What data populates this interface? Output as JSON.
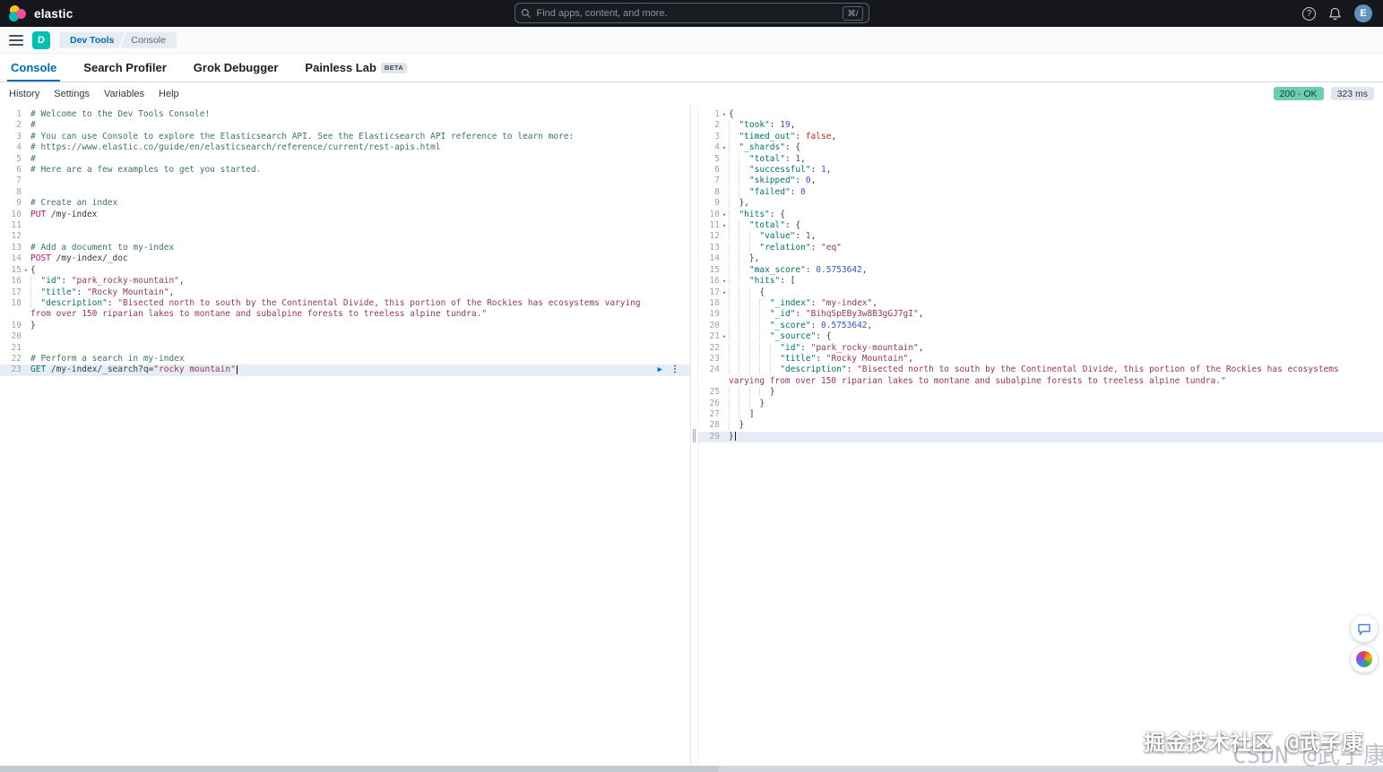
{
  "topbar": {
    "brand": "elastic",
    "search_placeholder": "Find apps, content, and more.",
    "search_shortcut": "⌘/",
    "avatar_initial": "E"
  },
  "breadcrumbs": {
    "space_initial": "D",
    "items": [
      "Dev Tools",
      "Console"
    ]
  },
  "tabs": [
    {
      "label": "Console",
      "active": true
    },
    {
      "label": "Search Profiler"
    },
    {
      "label": "Grok Debugger"
    },
    {
      "label": "Painless Lab",
      "badge": "BETA"
    }
  ],
  "toolbar": {
    "items": [
      "History",
      "Settings",
      "Variables",
      "Help"
    ],
    "status_badge": "200 - OK",
    "time_badge": "323 ms"
  },
  "icons": {
    "fold": "▾",
    "play": "▶",
    "kebab": "⋮",
    "help": "?"
  },
  "colors": {
    "accent": "#006bb4",
    "status_ok_bg": "#6dccb1",
    "method_pink": "#c80a68",
    "key_teal": "#00756c",
    "string_maroon": "#9a3558",
    "number_blue": "#3b53c4",
    "comment_green": "#41755c"
  },
  "watermark": {
    "primary": "掘金技术社区 @武子康",
    "secondary": "CSDN @武子康"
  },
  "editor": {
    "request_lines": [
      {
        "n": 1,
        "t": [
          [
            "c",
            "# Welcome to the Dev Tools Console!"
          ]
        ]
      },
      {
        "n": 2,
        "t": [
          [
            "c",
            "#"
          ]
        ]
      },
      {
        "n": 3,
        "t": [
          [
            "c",
            "# You can use Console to explore the Elasticsearch API. See the Elasticsearch API reference to learn more:"
          ]
        ]
      },
      {
        "n": 4,
        "t": [
          [
            "c",
            "# https://www.elastic.co/guide/en/elasticsearch/reference/current/rest-apis.html"
          ]
        ]
      },
      {
        "n": 5,
        "t": [
          [
            "c",
            "#"
          ]
        ]
      },
      {
        "n": 6,
        "t": [
          [
            "c",
            "# Here are a few examples to get you started."
          ]
        ]
      },
      {
        "n": 7,
        "t": []
      },
      {
        "n": 8,
        "t": []
      },
      {
        "n": 9,
        "t": [
          [
            "c",
            "# Create an index"
          ]
        ]
      },
      {
        "n": 10,
        "t": [
          [
            "m",
            "PUT"
          ],
          [
            "p",
            " "
          ],
          [
            "u",
            "/my-index"
          ]
        ]
      },
      {
        "n": 11,
        "t": []
      },
      {
        "n": 12,
        "t": []
      },
      {
        "n": 13,
        "t": [
          [
            "c",
            "# Add a document to my-index"
          ]
        ]
      },
      {
        "n": 14,
        "t": [
          [
            "m",
            "POST"
          ],
          [
            "p",
            " "
          ],
          [
            "u",
            "/my-index/_doc"
          ]
        ]
      },
      {
        "n": 15,
        "fold": true,
        "t": [
          [
            "p",
            "{"
          ]
        ]
      },
      {
        "n": 16,
        "t": [
          [
            "i",
            "  "
          ],
          [
            "k",
            "\"id\""
          ],
          [
            "p",
            ": "
          ],
          [
            "s",
            "\"park_rocky-mountain\""
          ],
          [
            "p",
            ","
          ]
        ]
      },
      {
        "n": 17,
        "t": [
          [
            "i",
            "  "
          ],
          [
            "k",
            "\"title\""
          ],
          [
            "p",
            ": "
          ],
          [
            "s",
            "\"Rocky Mountain\""
          ],
          [
            "p",
            ","
          ]
        ]
      },
      {
        "n": 18,
        "t": [
          [
            "i",
            "  "
          ],
          [
            "k",
            "\"description\""
          ],
          [
            "p",
            ": "
          ],
          [
            "s",
            "\"Bisected north to south by the Continental Divide, this portion of the Rockies has ecosystems varying from over 150 riparian lakes to montane and subalpine forests to treeless alpine tundra.\""
          ]
        ]
      },
      {
        "n": 19,
        "t": [
          [
            "p",
            "}"
          ]
        ]
      },
      {
        "n": 20,
        "t": []
      },
      {
        "n": 21,
        "t": []
      },
      {
        "n": 22,
        "t": [
          [
            "c",
            "# Perform a search in my-index"
          ]
        ]
      },
      {
        "n": 23,
        "hl": true,
        "cursor": true,
        "actions": true,
        "t": [
          [
            "gm",
            "GET"
          ],
          [
            "p",
            " "
          ],
          [
            "u",
            "/my-index/_search?q="
          ],
          [
            "s",
            "\"rocky mountain\""
          ]
        ]
      }
    ],
    "response_lines": [
      {
        "n": 1,
        "fold": true,
        "t": [
          [
            "p",
            "{"
          ]
        ]
      },
      {
        "n": 2,
        "t": [
          [
            "i",
            "  "
          ],
          [
            "k",
            "\"took\""
          ],
          [
            "p",
            ": "
          ],
          [
            "n",
            "19"
          ],
          [
            "p",
            ","
          ]
        ]
      },
      {
        "n": 3,
        "t": [
          [
            "i",
            "  "
          ],
          [
            "k",
            "\"timed_out\""
          ],
          [
            "p",
            ": "
          ],
          [
            "b",
            "false"
          ],
          [
            "p",
            ","
          ]
        ]
      },
      {
        "n": 4,
        "fold": true,
        "t": [
          [
            "i",
            "  "
          ],
          [
            "k",
            "\"_shards\""
          ],
          [
            "p",
            ": {"
          ]
        ]
      },
      {
        "n": 5,
        "t": [
          [
            "i",
            "  "
          ],
          [
            "i",
            "  "
          ],
          [
            "k",
            "\"total\""
          ],
          [
            "p",
            ": "
          ],
          [
            "n",
            "1"
          ],
          [
            "p",
            ","
          ]
        ]
      },
      {
        "n": 6,
        "t": [
          [
            "i",
            "  "
          ],
          [
            "i",
            "  "
          ],
          [
            "k",
            "\"successful\""
          ],
          [
            "p",
            ": "
          ],
          [
            "n",
            "1"
          ],
          [
            "p",
            ","
          ]
        ]
      },
      {
        "n": 7,
        "t": [
          [
            "i",
            "  "
          ],
          [
            "i",
            "  "
          ],
          [
            "k",
            "\"skipped\""
          ],
          [
            "p",
            ": "
          ],
          [
            "n",
            "0"
          ],
          [
            "p",
            ","
          ]
        ]
      },
      {
        "n": 8,
        "t": [
          [
            "i",
            "  "
          ],
          [
            "i",
            "  "
          ],
          [
            "k",
            "\"failed\""
          ],
          [
            "p",
            ": "
          ],
          [
            "n",
            "0"
          ]
        ]
      },
      {
        "n": 9,
        "t": [
          [
            "i",
            "  "
          ],
          [
            "p",
            "},"
          ]
        ]
      },
      {
        "n": 10,
        "fold": true,
        "t": [
          [
            "i",
            "  "
          ],
          [
            "k",
            "\"hits\""
          ],
          [
            "p",
            ": {"
          ]
        ]
      },
      {
        "n": 11,
        "fold": true,
        "t": [
          [
            "i",
            "  "
          ],
          [
            "i",
            "  "
          ],
          [
            "k",
            "\"total\""
          ],
          [
            "p",
            ": {"
          ]
        ]
      },
      {
        "n": 12,
        "t": [
          [
            "i",
            "  "
          ],
          [
            "i",
            "  "
          ],
          [
            "i",
            "  "
          ],
          [
            "k",
            "\"value\""
          ],
          [
            "p",
            ": "
          ],
          [
            "n",
            "1"
          ],
          [
            "p",
            ","
          ]
        ]
      },
      {
        "n": 13,
        "t": [
          [
            "i",
            "  "
          ],
          [
            "i",
            "  "
          ],
          [
            "i",
            "  "
          ],
          [
            "k",
            "\"relation\""
          ],
          [
            "p",
            ": "
          ],
          [
            "s",
            "\"eq\""
          ]
        ]
      },
      {
        "n": 14,
        "t": [
          [
            "i",
            "  "
          ],
          [
            "i",
            "  "
          ],
          [
            "p",
            "},"
          ]
        ]
      },
      {
        "n": 15,
        "t": [
          [
            "i",
            "  "
          ],
          [
            "i",
            "  "
          ],
          [
            "k",
            "\"max_score\""
          ],
          [
            "p",
            ": "
          ],
          [
            "n",
            "0.5753642"
          ],
          [
            "p",
            ","
          ]
        ]
      },
      {
        "n": 16,
        "fold": true,
        "t": [
          [
            "i",
            "  "
          ],
          [
            "i",
            "  "
          ],
          [
            "k",
            "\"hits\""
          ],
          [
            "p",
            ": ["
          ]
        ]
      },
      {
        "n": 17,
        "fold": true,
        "t": [
          [
            "i",
            "  "
          ],
          [
            "i",
            "  "
          ],
          [
            "i",
            "  "
          ],
          [
            "p",
            "{"
          ]
        ]
      },
      {
        "n": 18,
        "t": [
          [
            "i",
            "  "
          ],
          [
            "i",
            "  "
          ],
          [
            "i",
            "  "
          ],
          [
            "i",
            "  "
          ],
          [
            "k",
            "\"_index\""
          ],
          [
            "p",
            ": "
          ],
          [
            "s",
            "\"my-index\""
          ],
          [
            "p",
            ","
          ]
        ]
      },
      {
        "n": 19,
        "t": [
          [
            "i",
            "  "
          ],
          [
            "i",
            "  "
          ],
          [
            "i",
            "  "
          ],
          [
            "i",
            "  "
          ],
          [
            "k",
            "\"_id\""
          ],
          [
            "p",
            ": "
          ],
          [
            "s",
            "\"BihqSpEBy3w8B3gGJ7gI\""
          ],
          [
            "p",
            ","
          ]
        ]
      },
      {
        "n": 20,
        "t": [
          [
            "i",
            "  "
          ],
          [
            "i",
            "  "
          ],
          [
            "i",
            "  "
          ],
          [
            "i",
            "  "
          ],
          [
            "k",
            "\"_score\""
          ],
          [
            "p",
            ": "
          ],
          [
            "n",
            "0.5753642"
          ],
          [
            "p",
            ","
          ]
        ]
      },
      {
        "n": 21,
        "fold": true,
        "t": [
          [
            "i",
            "  "
          ],
          [
            "i",
            "  "
          ],
          [
            "i",
            "  "
          ],
          [
            "i",
            "  "
          ],
          [
            "k",
            "\"_source\""
          ],
          [
            "p",
            ": {"
          ]
        ]
      },
      {
        "n": 22,
        "t": [
          [
            "i",
            "  "
          ],
          [
            "i",
            "  "
          ],
          [
            "i",
            "  "
          ],
          [
            "i",
            "  "
          ],
          [
            "i",
            "  "
          ],
          [
            "k",
            "\"id\""
          ],
          [
            "p",
            ": "
          ],
          [
            "s",
            "\"park_rocky-mountain\""
          ],
          [
            "p",
            ","
          ]
        ]
      },
      {
        "n": 23,
        "t": [
          [
            "i",
            "  "
          ],
          [
            "i",
            "  "
          ],
          [
            "i",
            "  "
          ],
          [
            "i",
            "  "
          ],
          [
            "i",
            "  "
          ],
          [
            "k",
            "\"title\""
          ],
          [
            "p",
            ": "
          ],
          [
            "s",
            "\"Rocky Mountain\""
          ],
          [
            "p",
            ","
          ]
        ]
      },
      {
        "n": 24,
        "t": [
          [
            "i",
            "  "
          ],
          [
            "i",
            "  "
          ],
          [
            "i",
            "  "
          ],
          [
            "i",
            "  "
          ],
          [
            "i",
            "  "
          ],
          [
            "k",
            "\"description\""
          ],
          [
            "p",
            ": "
          ],
          [
            "s",
            "\"Bisected north to south by the Continental Divide, this portion of the Rockies has ecosystems varying from over 150 riparian lakes to montane and subalpine forests to treeless alpine tundra.\""
          ]
        ]
      },
      {
        "n": 25,
        "t": [
          [
            "i",
            "  "
          ],
          [
            "i",
            "  "
          ],
          [
            "i",
            "  "
          ],
          [
            "i",
            "  "
          ],
          [
            "p",
            "}"
          ]
        ]
      },
      {
        "n": 26,
        "t": [
          [
            "i",
            "  "
          ],
          [
            "i",
            "  "
          ],
          [
            "i",
            "  "
          ],
          [
            "p",
            "}"
          ]
        ]
      },
      {
        "n": 27,
        "t": [
          [
            "i",
            "  "
          ],
          [
            "i",
            "  "
          ],
          [
            "p",
            "]"
          ]
        ]
      },
      {
        "n": 28,
        "t": [
          [
            "i",
            "  "
          ],
          [
            "p",
            "}"
          ]
        ]
      },
      {
        "n": 29,
        "hl": true,
        "cursor": true,
        "t": [
          [
            "p",
            "}"
          ]
        ]
      }
    ]
  }
}
